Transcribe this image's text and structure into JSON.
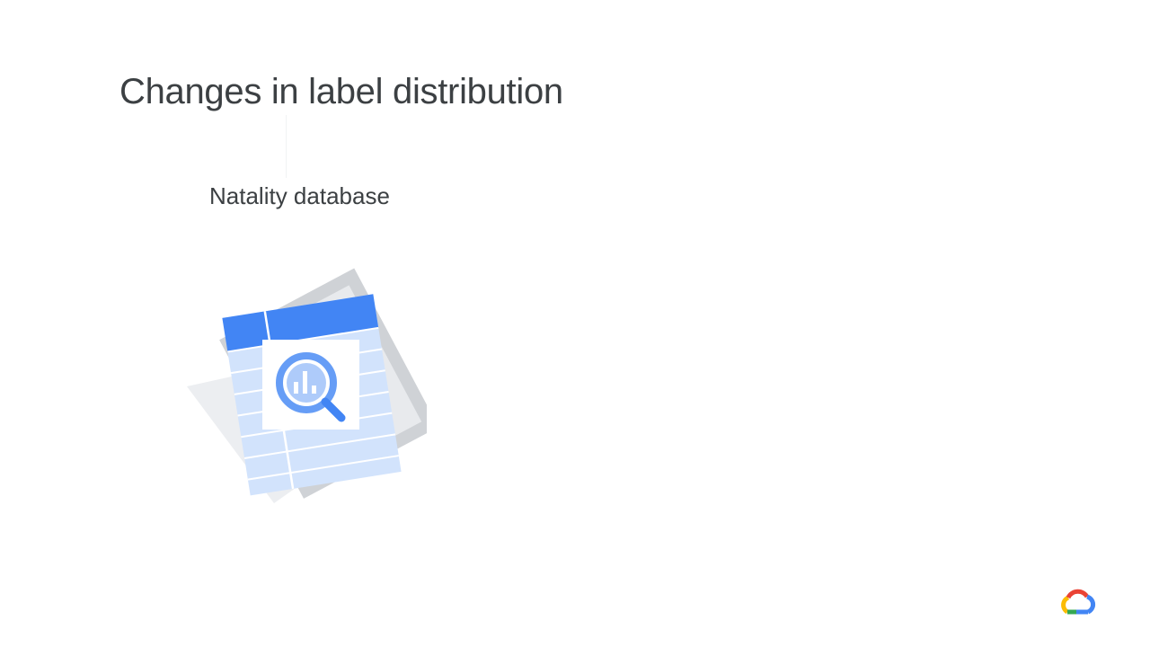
{
  "slide": {
    "title": "Changes in label distribution",
    "subtitle": "Natality database"
  },
  "icons": {
    "illustration": "bigquery-table-icon",
    "logo": "google-cloud-logo"
  },
  "colors": {
    "text": "#3c4043",
    "table_header": "#4285f4",
    "table_body": "#d2e3fc",
    "magnifier": "#669df6",
    "back_sheet_dark": "#cfd2d6",
    "back_sheet_light": "#eceef1",
    "logo_red": "#ea4335",
    "logo_blue": "#4285f4",
    "logo_yellow": "#fbbc04",
    "logo_green": "#34a853"
  }
}
